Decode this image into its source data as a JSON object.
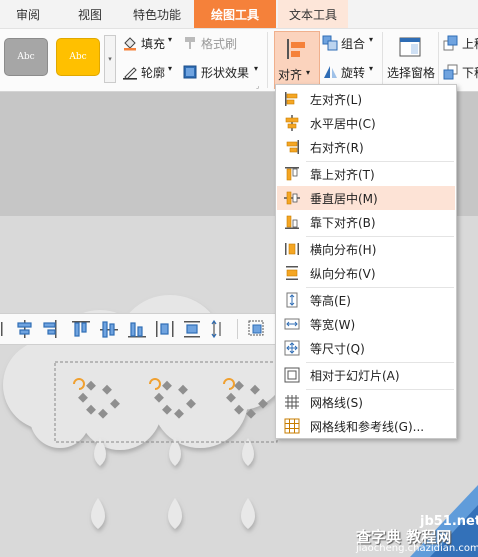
{
  "tabs": [
    "审阅",
    "视图",
    "特色功能",
    "绘图工具",
    "文本工具"
  ],
  "active_tab": "绘图工具",
  "ribbon": {
    "style_sample": "Abc",
    "fill": "填充",
    "format_painter": "格式刷",
    "outline": "轮廓",
    "shape_effect": "形状效果",
    "align": "对齐",
    "group": "组合",
    "rotate": "旋转",
    "selection_pane": "选择窗格",
    "up": "上移",
    "down": "下移"
  },
  "align_menu": [
    {
      "label": "左对齐(L)",
      "icon": "align-left-icon"
    },
    {
      "label": "水平居中(C)",
      "icon": "align-center-h-icon"
    },
    {
      "label": "右对齐(R)",
      "icon": "align-right-icon"
    },
    {
      "label": "靠上对齐(T)",
      "icon": "align-top-icon"
    },
    {
      "label": "垂直居中(M)",
      "icon": "align-middle-icon",
      "highlighted": true
    },
    {
      "label": "靠下对齐(B)",
      "icon": "align-bottom-icon"
    },
    {
      "label": "横向分布(H)",
      "icon": "distribute-h-icon"
    },
    {
      "label": "纵向分布(V)",
      "icon": "distribute-v-icon"
    },
    {
      "label": "等高(E)",
      "icon": "same-height-icon"
    },
    {
      "label": "等宽(W)",
      "icon": "same-width-icon"
    },
    {
      "label": "等尺寸(Q)",
      "icon": "same-size-icon"
    },
    {
      "label": "相对于幻灯片(A)",
      "icon": "relative-slide-icon"
    },
    {
      "label": "网格线(S)",
      "icon": "gridlines-icon"
    },
    {
      "label": "网格线和参考线(G)...",
      "icon": "grid-guides-icon"
    }
  ],
  "watermark": {
    "site": "jb51.net",
    "brand": "查字典 教程网",
    "url": "jiaocheng.chazidian.com"
  },
  "colors": {
    "accent": "#f5813a",
    "highlight": "#fde3d6",
    "orange_style": "#ffc000",
    "gray_style": "#a6a6a6"
  }
}
